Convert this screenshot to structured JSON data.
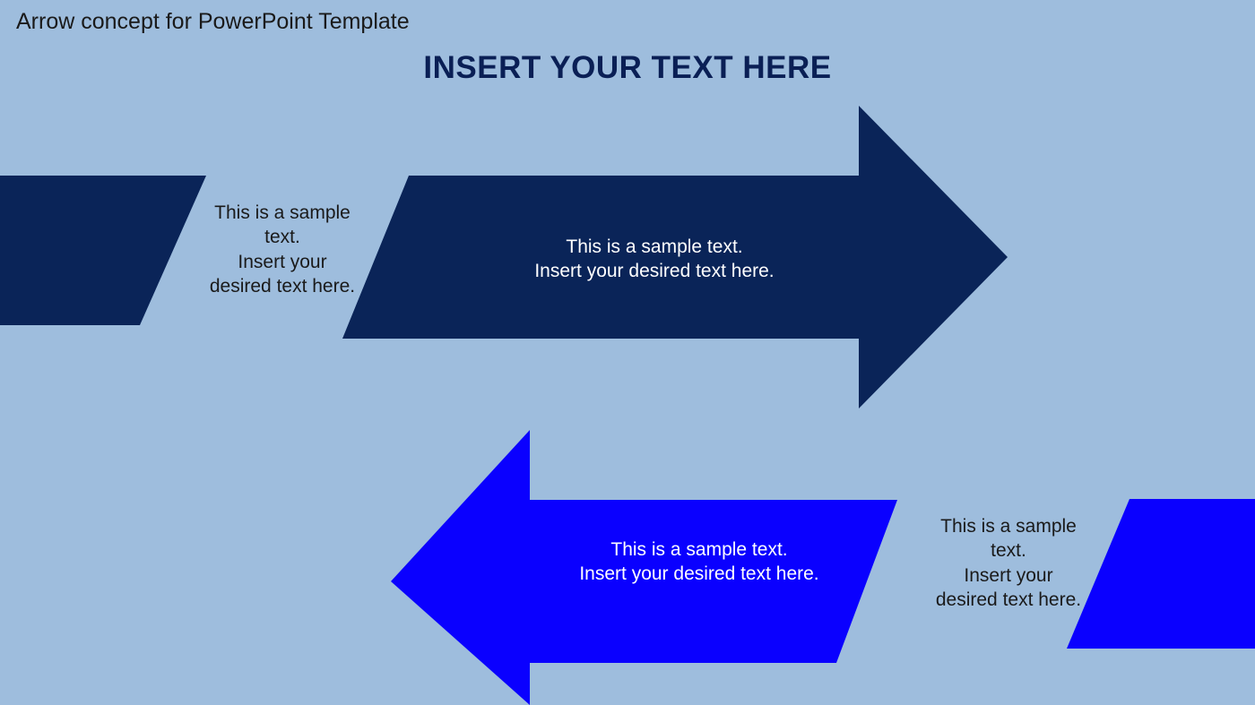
{
  "slide_label": "Arrow concept for PowerPoint Template",
  "main_title": "INSERT YOUR TEXT HERE",
  "colors": {
    "background": "#9ebddd",
    "arrow_dark": "#0a2458",
    "arrow_bright": "#0a00ff",
    "title_color": "#0a1f55"
  },
  "arrow1": {
    "body_text": "This is a sample text.\nInsert your desired text here."
  },
  "note1": {
    "text": "This is a sample text.\nInsert your desired text here."
  },
  "arrow2": {
    "body_text": "This is a sample text.\nInsert your desired text here."
  },
  "note2": {
    "text": "This is a sample text.\nInsert your desired text here."
  }
}
